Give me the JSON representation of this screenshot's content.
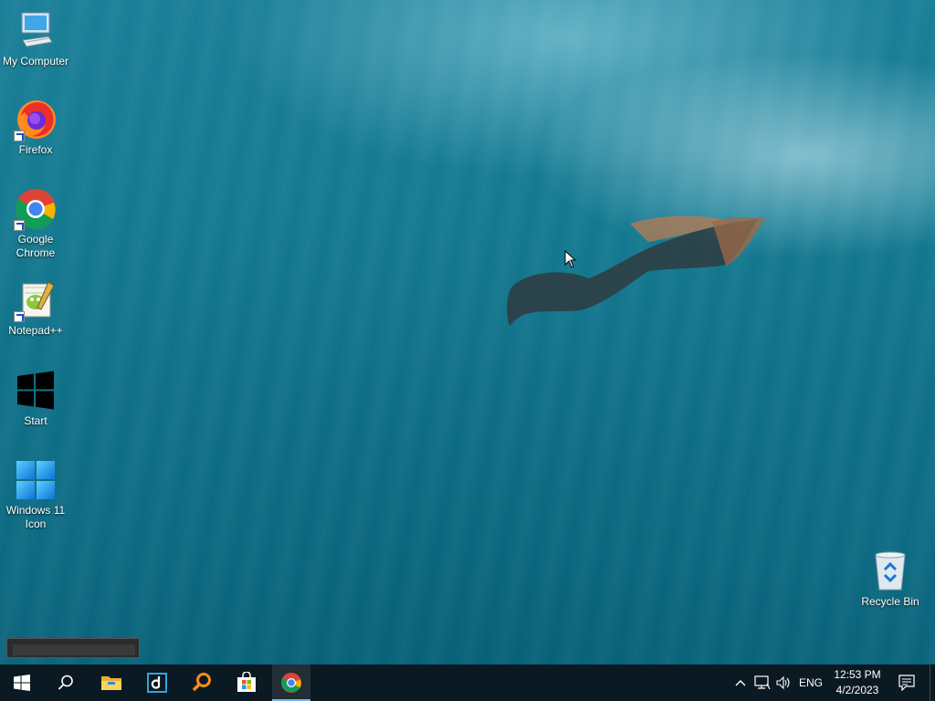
{
  "desktop": {
    "icons": [
      {
        "label": "My Computer",
        "icon": "computer-icon"
      },
      {
        "label": "Firefox",
        "icon": "firefox-icon"
      },
      {
        "label": "Google Chrome",
        "icon": "chrome-icon"
      },
      {
        "label": "Notepad++",
        "icon": "notepadplusplus-icon"
      },
      {
        "label": "Start",
        "icon": "windows-logo-icon"
      },
      {
        "label": "Windows 11 Icon",
        "icon": "windows11-logo-icon"
      }
    ],
    "recycle_bin": {
      "label": "Recycle Bin",
      "icon": "recycle-bin-icon"
    }
  },
  "taskbar": {
    "buttons": [
      {
        "name": "start",
        "icon": "windows-logo-icon"
      },
      {
        "name": "search",
        "icon": "search-icon"
      },
      {
        "name": "file-explorer",
        "icon": "folder-icon"
      },
      {
        "name": "app-d",
        "icon": "app-d-icon"
      },
      {
        "name": "search-everything",
        "icon": "magnifier-orange-icon"
      },
      {
        "name": "microsoft-store",
        "icon": "store-icon"
      },
      {
        "name": "chrome",
        "icon": "chrome-icon",
        "active": true
      }
    ],
    "tray": {
      "language": "ENG",
      "time": "12:53 PM",
      "date": "4/2/2023"
    }
  },
  "colors": {
    "taskbar": "#0b1a22",
    "accent": "#7ab3e8"
  }
}
